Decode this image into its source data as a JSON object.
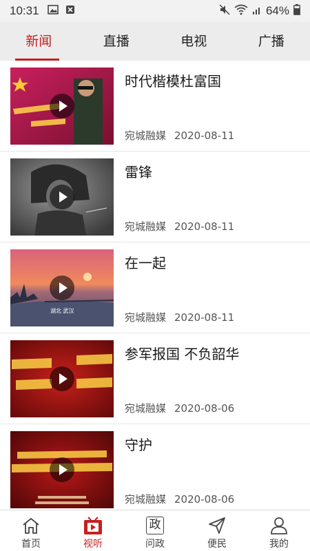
{
  "status_bar": {
    "time": "10:31",
    "battery": "64%"
  },
  "top_tabs": [
    {
      "label": "新闻",
      "active": true
    },
    {
      "label": "直播",
      "active": false
    },
    {
      "label": "电视",
      "active": false
    },
    {
      "label": "广播",
      "active": false
    }
  ],
  "news": [
    {
      "title": "时代楷模杜富国",
      "source": "宛城融媒",
      "date": "2020-08-11",
      "thumb_caption": ""
    },
    {
      "title": "雷锋",
      "source": "宛城融媒",
      "date": "2020-08-11",
      "thumb_caption": ""
    },
    {
      "title": "在一起",
      "source": "宛城融媒",
      "date": "2020-08-11",
      "thumb_caption": "湖北 武汉"
    },
    {
      "title": "参军报国 不负韶华",
      "source": "宛城融媒",
      "date": "2020-08-06",
      "thumb_caption": ""
    },
    {
      "title": "守护",
      "source": "宛城融媒",
      "date": "2020-08-06",
      "thumb_caption": ""
    }
  ],
  "bottom_nav": [
    {
      "label": "首页",
      "icon": "home-icon",
      "active": false
    },
    {
      "label": "视听",
      "icon": "video-icon",
      "active": true
    },
    {
      "label": "问政",
      "icon": "zheng-icon",
      "icon_text": "政",
      "active": false
    },
    {
      "label": "便民",
      "icon": "send-icon",
      "active": false
    },
    {
      "label": "我的",
      "icon": "user-icon",
      "active": false
    }
  ],
  "colors": {
    "accent": "#c7201f"
  }
}
